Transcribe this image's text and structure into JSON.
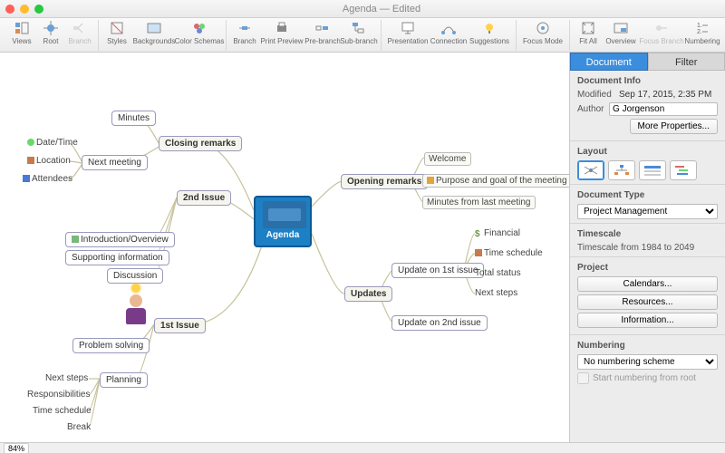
{
  "window": {
    "title": "Agenda — Edited"
  },
  "toolbar": {
    "views": "Views",
    "root": "Root",
    "branch": "Branch",
    "styles": "Styles",
    "backgrounds": "Backgrounds",
    "colorschemas": "Color Schemas",
    "branch2": "Branch",
    "printpreview": "Print Preview",
    "prebranch": "Pre-branch",
    "subbranch": "Sub-branch",
    "presentation": "Presentation",
    "connection": "Connection",
    "suggestions": "Suggestions",
    "focusmode": "Focus Mode",
    "fitall": "Fit All",
    "overview": "Overview",
    "focusbranch": "Focus Branch",
    "numbering": "Numbering"
  },
  "mindmap": {
    "root": "Agenda",
    "topics": {
      "closing": "Closing remarks",
      "closing_minutes": "Minutes",
      "closing_next": "Next meeting",
      "closing_date": "Date/Time",
      "closing_location": "Location",
      "closing_attendees": "Attendees",
      "second": "2nd Issue",
      "second_intro": "Introduction/Overview",
      "second_support": "Supporting information",
      "second_disc": "Discussion",
      "first": "1st Issue",
      "first_problem": "Problem solving",
      "first_plan": "Planning",
      "first_next": "Next steps",
      "first_resp": "Responsibilities",
      "first_time": "Time schedule",
      "first_break": "Break",
      "opening": "Opening remarks",
      "opening_welcome": "Welcome",
      "opening_purpose": "Purpose and goal of the meeting",
      "opening_prevmin": "Minutes from last meeting",
      "updates": "Updates",
      "upd1": "Update on 1st issue",
      "upd2": "Update on 2nd issue",
      "upd_fin": "Financial",
      "upd_time": "Time schedule",
      "upd_total": "Total status",
      "upd_next": "Next steps"
    }
  },
  "panel": {
    "tab_document": "Document",
    "tab_filter": "Filter",
    "docinfo": "Document Info",
    "modified_lbl": "Modified",
    "modified_val": "Sep 17, 2015, 2:35 PM",
    "author_lbl": "Author",
    "author_val": "G Jorgenson",
    "moreprops": "More Properties...",
    "layout": "Layout",
    "doctype": "Document Type",
    "doctype_val": "Project Management",
    "timescale": "Timescale",
    "timescale_text": "Timescale from 1984 to 2049",
    "project": "Project",
    "calendars": "Calendars...",
    "resources": "Resources...",
    "information": "Information...",
    "numbering": "Numbering",
    "numbering_val": "No numbering scheme",
    "numbering_chk": "Start numbering from root"
  },
  "status": {
    "zoom": "84%"
  }
}
